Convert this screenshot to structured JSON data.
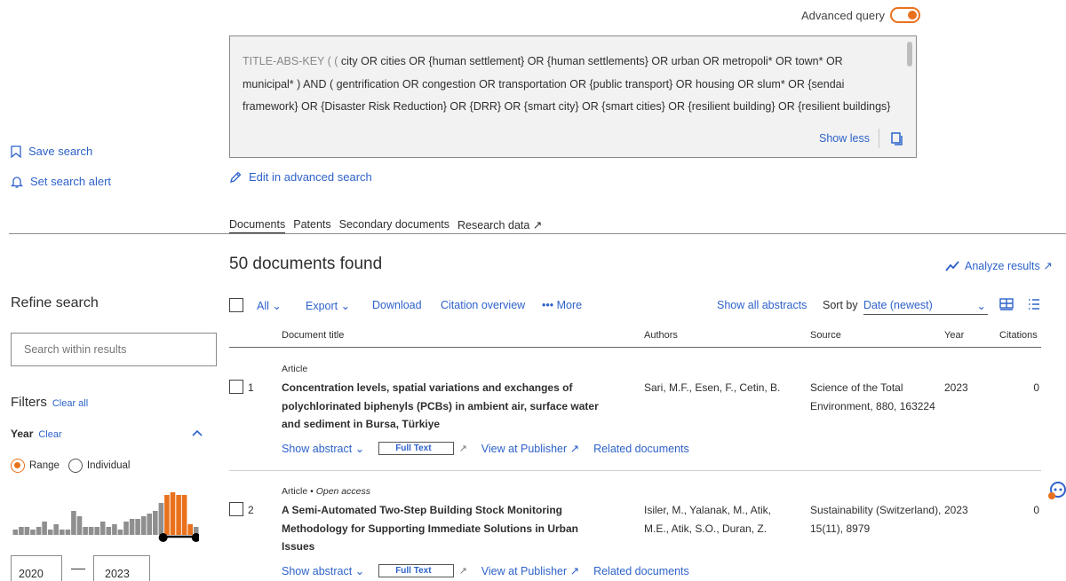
{
  "advanced_query": {
    "label": "Advanced query",
    "enabled": true
  },
  "query": {
    "prefix": "TITLE-ABS-KEY ( ( ",
    "text_line1": "city OR cities OR {human settlement} OR {human settlements} OR urban OR metropoli* OR town* OR",
    "text_line2": "municipal* ) AND ( gentrification OR congestion OR transportation OR {public transport} OR housing OR slum* OR {sendai",
    "text_line3": "framework} OR {Disaster Risk Reduction} OR {DRR} OR {smart city} OR {smart cities} OR {resilient building} OR {resilient buildings}",
    "show_less": "Show less"
  },
  "left": {
    "save_search": "Save search",
    "set_alert": "Set search alert",
    "refine": "Refine search",
    "search_within_placeholder": "Search within results",
    "filters": "Filters",
    "clear_all": "Clear all",
    "year": "Year",
    "year_clear": "Clear",
    "range": "Range",
    "individual": "Individual",
    "year_from": "2020",
    "year_to": "2023",
    "histogram": [
      2,
      3,
      3,
      2,
      3,
      5,
      2,
      4,
      2,
      2,
      9,
      7,
      3,
      3,
      3,
      5,
      3,
      4,
      2,
      5,
      6,
      6,
      7,
      8,
      9,
      12,
      15,
      16,
      15,
      15,
      4,
      3
    ]
  },
  "edit_advanced": "Edit in advanced search",
  "tabs": [
    "Documents",
    "Patents",
    "Secondary documents",
    "Research data ↗"
  ],
  "results_count": "50 documents found",
  "analyze": "Analyze results ↗",
  "toolbar": {
    "all": "All",
    "export": "Export",
    "download": "Download",
    "citation_overview": "Citation overview",
    "more": "More",
    "show_all_abstracts": "Show all abstracts",
    "sort_by": "Sort by",
    "sort_value": "Date (newest)"
  },
  "columns": {
    "title": "Document title",
    "authors": "Authors",
    "source": "Source",
    "year": "Year",
    "citations": "Citations"
  },
  "results": [
    {
      "num": "1",
      "type": "Article",
      "title": "Concentration levels, spatial variations and exchanges of polychlorinated biphenyls (PCBs) in ambient air, surface water and sediment in Bursa, Türkiye",
      "authors": "Sari, M.F., Esen, F., Cetin, B.",
      "source": "Science of the Total Environment, 880, 163224",
      "year": "2023",
      "citations": "0",
      "show_abstract": "Show abstract",
      "full_text": "Full Text",
      "view_publisher": "View at Publisher ↗",
      "related": "Related documents"
    },
    {
      "num": "2",
      "type": "Article",
      "open_access": "Open access",
      "title": "A Semi-Automated Two-Step Building Stock Monitoring Methodology for Supporting Immediate Solutions in Urban Issues",
      "authors": "Isiler, M., Yalanak, M., Atik, M.E., Atik, S.O., Duran, Z.",
      "source": "Sustainability (Switzerland), 15(11), 8979",
      "year": "2023",
      "citations": "0",
      "show_abstract": "Show abstract",
      "full_text": "Full Text",
      "view_publisher": "View at Publisher ↗",
      "related": "Related documents"
    }
  ],
  "colors": {
    "accent": "#e9711c",
    "link": "#2e62c9"
  }
}
